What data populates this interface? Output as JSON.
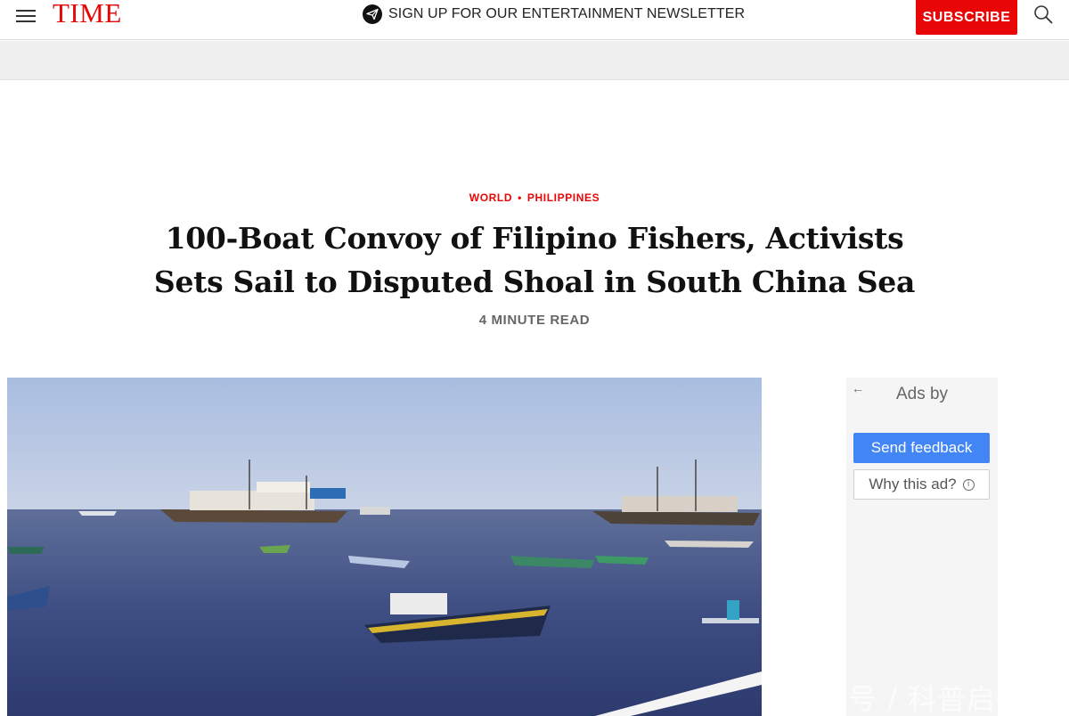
{
  "header": {
    "logo": "TIME",
    "newsletter_label": "SIGN UP FOR OUR ENTERTAINMENT NEWSLETTER",
    "subscribe_label": "SUBSCRIBE",
    "icons": {
      "menu": "hamburger-menu-icon",
      "newsletter": "paper-plane-icon",
      "search": "search-icon"
    },
    "colors": {
      "brand_red": "#e90606"
    }
  },
  "article": {
    "kicker_section": "WORLD",
    "kicker_separator": "•",
    "kicker_topic": "PHILIPPINES",
    "headline": "100-Boat Convoy of Filipino Fishers, Activists Sets Sail to Disputed Shoal in South China Sea",
    "read_time": "4 MINUTE READ"
  },
  "ad_sidebar": {
    "back_arrow": "←",
    "ads_by": "Ads by",
    "send_feedback": "Send feedback",
    "why_this_ad": "Why this ad?",
    "watermark": "号 / 科普启",
    "colors": {
      "feedback_button": "#4285f4"
    }
  }
}
